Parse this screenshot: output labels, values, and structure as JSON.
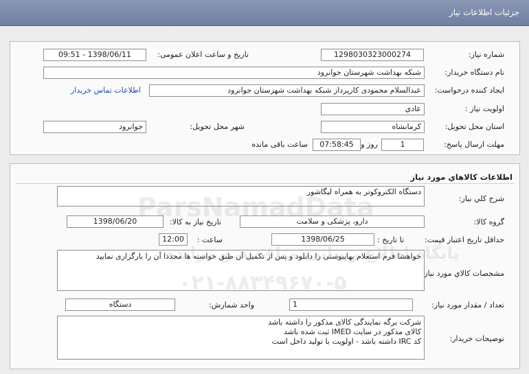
{
  "header": {
    "title": "جزئيات اطلاعات نياز"
  },
  "info": {
    "need_number_label": "شماره نياز:",
    "need_number": "1298030323000274",
    "announce_label": "تاريخ و ساعت اعلان عمومی:",
    "announce_value": "1398/06/11 - 09:51",
    "buyer_label": "نام دستگاه خريدار:",
    "buyer_value": "شبکه بهداشت شهرستان جوانرود",
    "creator_label": "ايجاد کننده درخواست:",
    "creator_value": "عبدالسلام محمودی کارپرداز شبکه بهداشت شهرستان جوانرود",
    "contact_link": "اطلاعات تماس خريدار",
    "priority_label": "اولويت نياز :",
    "priority_value": "عادي",
    "province_label": "استان محل تحويل:",
    "province_value": "کرمانشاه",
    "city_label": "شهر محل تحويل:",
    "city_value": "جوانرود",
    "deadline_label": "مهلت ارسال پاسخ:",
    "deadline_days": "1",
    "days_label": "روز و",
    "deadline_time": "07:58:45",
    "remaining_label": "ساعت باقی مانده"
  },
  "goods": {
    "section_title": "اطلاعات کالاهاي مورد نياز",
    "description_label": "شرح کلي نياز:",
    "description_value": "دستگاه الکتروکوتر به همراه ليگاشور",
    "group_label": "گروه کالا:",
    "group_value": "دارو، پزشکی و سلامت",
    "need_date_label": "تاريخ نياز به کالا:",
    "need_date_value": "1398/06/20",
    "min_validity_label": "حداقل تاريخ اعتبار قيمت:",
    "until_date_label": "تا تاريخ :",
    "until_date_value": "1398/06/25",
    "time_label": "ساعت :",
    "time_value": "12:00",
    "specs_label": "مشخصات کالاي مورد نياز:",
    "specs_value": "خواهشا فرم استعلام بهاپیوستی را دانلود و پس از تکمیل آن طبق خواسته ها مجددا آن را بارگزاری نمایید",
    "quantity_label": "تعداد / مقدار مورد نياز:",
    "quantity_value": "1",
    "unit_label": "واحد شمارش:",
    "unit_value": "دستگاه",
    "buyer_notes_label": "توضيحات خريدار:",
    "buyer_notes": [
      "شرکت برگه نمایندگی کالای مذکور را داشته باشد",
      "کالای مذکور در سایت IMED ثبت شده باشد",
      "کد IRC داشته باشد - اولویت با تولید داخل است"
    ]
  },
  "watermark": {
    "brand": "ParsNamadData",
    "site_line": "پایگاه اطلاع رسانی مناقصه و مزایده",
    "phone": "۰۲۱-۸۸۳۴۹۶۷۰-۵"
  }
}
